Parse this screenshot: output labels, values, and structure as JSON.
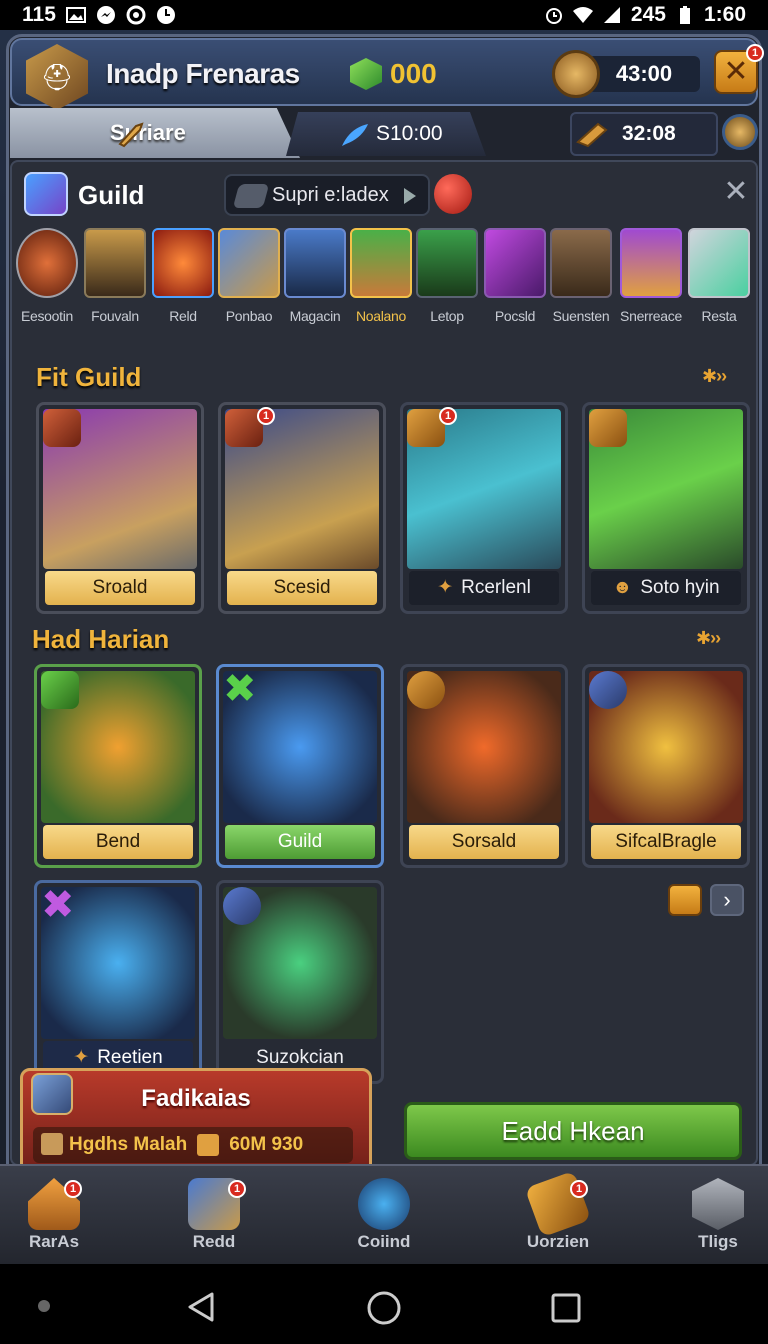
{
  "status_bar": {
    "left_text": "115",
    "network": "245",
    "time": "1:60"
  },
  "header": {
    "player_name": "Inadp Frenaras",
    "gems": "000",
    "timer": "43:00",
    "close_badge": "1"
  },
  "tabs": {
    "tab1": "Suriare",
    "tab2": "S10:00",
    "tab3": "32:08"
  },
  "guild": {
    "title": "Guild",
    "search_text": "Supri e:ladex"
  },
  "heroes": [
    "Eesootin",
    "Fouvaln",
    "Reld",
    "Ponbao",
    "Magacin",
    "Noalano",
    "Letop",
    "Pocsld",
    "Suensten",
    "Snerreace",
    "Resta"
  ],
  "section1": {
    "title": "Fit Guild",
    "cards": [
      "Sroald",
      "Scesid",
      "Rcerlenl",
      "Soto hyin"
    ]
  },
  "section2": {
    "title": "Had Harian",
    "cards": [
      "Bend",
      "Guild",
      "Sorsald",
      "SifcalBragle"
    ]
  },
  "section3": {
    "cards": [
      "Reetien",
      "Suzokcian"
    ]
  },
  "promo": {
    "title": "Fadikaias",
    "label": "Hgdhs Malah",
    "value": "60M 930"
  },
  "cta": {
    "label": "Eadd Hkean"
  },
  "bottom_nav": [
    {
      "label": "RarAs",
      "badge": "1"
    },
    {
      "label": "Redd",
      "badge": "1"
    },
    {
      "label": "Coiind",
      "badge": ""
    },
    {
      "label": "Uorzien",
      "badge": "1"
    },
    {
      "label": "Tligs",
      "badge": ""
    }
  ],
  "card_badges": [
    "1",
    "1"
  ]
}
